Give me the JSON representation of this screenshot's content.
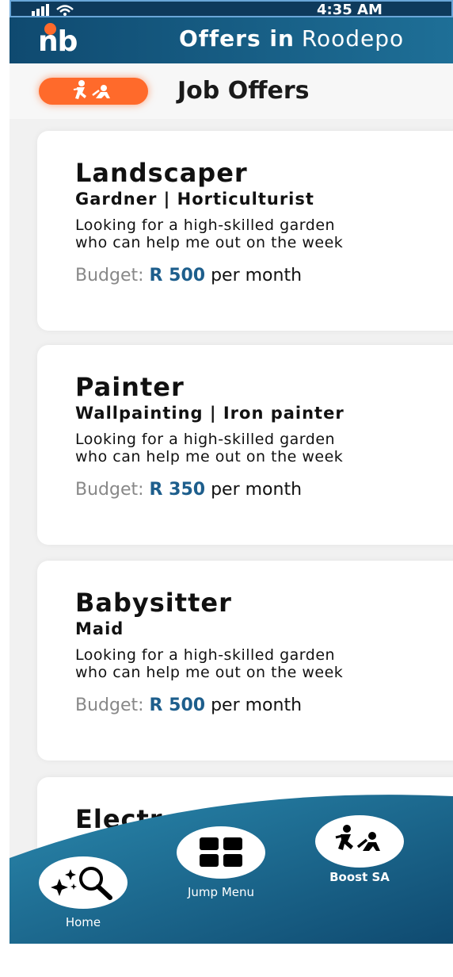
{
  "status_bar": {
    "time": "4:35 AM"
  },
  "header": {
    "logo_text": "nb",
    "title_prefix": "Offers in",
    "location": "Roodepo"
  },
  "section": {
    "title": "Job Offers"
  },
  "jobs": [
    {
      "title": "Landscaper",
      "subtitle": "Gardner  |  Horticulturist",
      "desc_line1": "Looking for a high-skilled garden",
      "desc_line2": "who can help me out on the week",
      "budget_label": "Budget:",
      "budget_amount": "R 500",
      "budget_period": "per month"
    },
    {
      "title": "Painter",
      "subtitle": "Wallpainting  |  Iron painter",
      "desc_line1": "Looking for a high-skilled garden",
      "desc_line2": "who can help me out on the week",
      "budget_label": "Budget:",
      "budget_amount": "R 350",
      "budget_period": "per month"
    },
    {
      "title": "Babysitter",
      "subtitle": "Maid",
      "desc_line1": "Looking for a high-skilled garden",
      "desc_line2": "who can help me out on the week",
      "budget_label": "Budget:",
      "budget_amount": "R 500",
      "budget_period": "per month"
    },
    {
      "title": "Electr"
    }
  ],
  "nav": {
    "home": "Home",
    "jump_menu": "Jump Menu",
    "boost": "Boost SA"
  },
  "colors": {
    "brand_orange": "#ff6a2b",
    "header_blue": "#0f4a70",
    "amount_blue": "#1d5e8c"
  }
}
